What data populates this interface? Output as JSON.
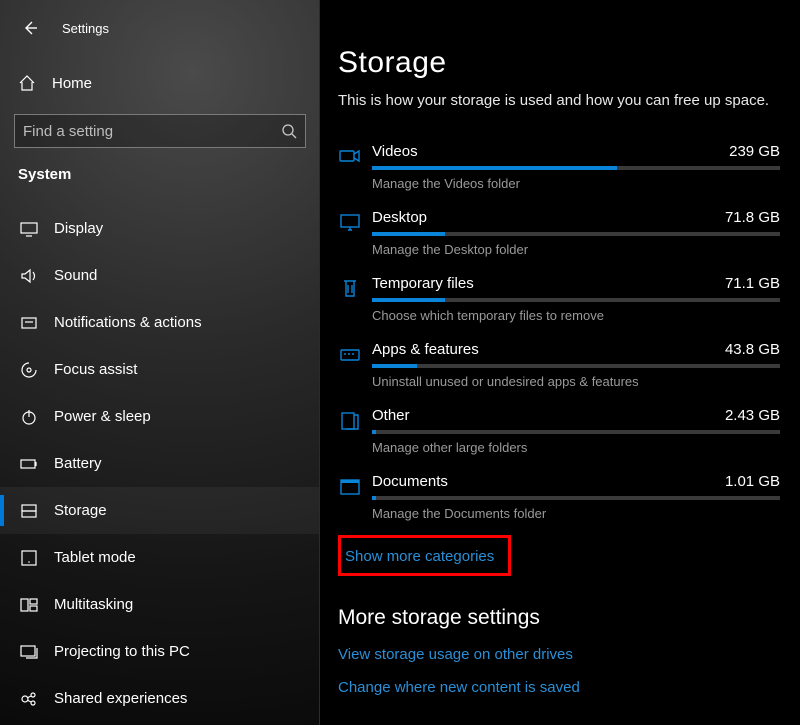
{
  "header": {
    "title": "Settings"
  },
  "home": {
    "label": "Home"
  },
  "search": {
    "placeholder": "Find a setting"
  },
  "section": "System",
  "nav": [
    {
      "id": "display",
      "label": "Display",
      "icon": "display",
      "selected": false
    },
    {
      "id": "sound",
      "label": "Sound",
      "icon": "sound",
      "selected": false
    },
    {
      "id": "notifications",
      "label": "Notifications & actions",
      "icon": "notifications",
      "selected": false
    },
    {
      "id": "focus",
      "label": "Focus assist",
      "icon": "focus",
      "selected": false
    },
    {
      "id": "power",
      "label": "Power & sleep",
      "icon": "power",
      "selected": false
    },
    {
      "id": "battery",
      "label": "Battery",
      "icon": "battery",
      "selected": false
    },
    {
      "id": "storage",
      "label": "Storage",
      "icon": "storage",
      "selected": true
    },
    {
      "id": "tablet",
      "label": "Tablet mode",
      "icon": "tablet",
      "selected": false
    },
    {
      "id": "multitasking",
      "label": "Multitasking",
      "icon": "multitasking",
      "selected": false
    },
    {
      "id": "projecting",
      "label": "Projecting to this PC",
      "icon": "projecting",
      "selected": false
    },
    {
      "id": "shared",
      "label": "Shared experiences",
      "icon": "shared",
      "selected": false
    }
  ],
  "page": {
    "title": "Storage",
    "subtitle": "This is how your storage is used and how you can free up space."
  },
  "categories": [
    {
      "id": "videos",
      "name": "Videos",
      "size": "239 GB",
      "desc": "Manage the Videos folder",
      "fill": 60
    },
    {
      "id": "desktop",
      "name": "Desktop",
      "size": "71.8 GB",
      "desc": "Manage the Desktop folder",
      "fill": 18
    },
    {
      "id": "temp",
      "name": "Temporary files",
      "size": "71.1 GB",
      "desc": "Choose which temporary files to remove",
      "fill": 18
    },
    {
      "id": "apps",
      "name": "Apps & features",
      "size": "43.8 GB",
      "desc": "Uninstall unused or undesired apps & features",
      "fill": 11
    },
    {
      "id": "other",
      "name": "Other",
      "size": "2.43 GB",
      "desc": "Manage other large folders",
      "fill": 1
    },
    {
      "id": "documents",
      "name": "Documents",
      "size": "1.01 GB",
      "desc": "Manage the Documents folder",
      "fill": 1
    }
  ],
  "show_more": "Show more categories",
  "more": {
    "header": "More storage settings",
    "links": [
      "View storage usage on other drives",
      "Change where new content is saved"
    ]
  }
}
